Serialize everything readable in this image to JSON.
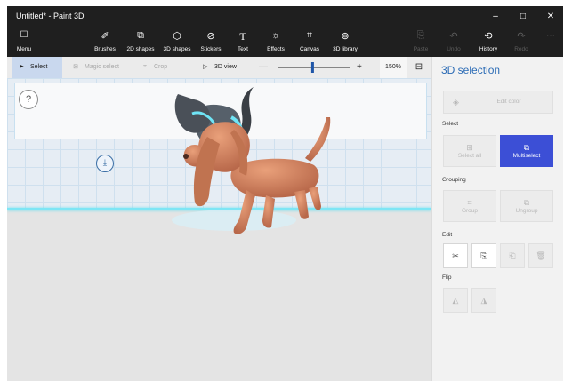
{
  "window": {
    "title": "Untitled* - Paint 3D",
    "controls": [
      {
        "name": "minimize-button",
        "glyph": "–"
      },
      {
        "name": "maximize-button",
        "glyph": "□"
      },
      {
        "name": "close-button",
        "glyph": "✕"
      }
    ]
  },
  "ribbon": {
    "menu": {
      "label": "Menu",
      "icon": "menu-icon",
      "glyph": "☐"
    },
    "tools": [
      {
        "label": "Brushes",
        "icon": "brush-icon",
        "glyph": "✐"
      },
      {
        "label": "2D shapes",
        "icon": "2d-shapes-icon",
        "glyph": "⧉"
      },
      {
        "label": "3D shapes",
        "icon": "3d-shapes-icon",
        "glyph": "⬡"
      },
      {
        "label": "Stickers",
        "icon": "stickers-icon",
        "glyph": "⊘"
      },
      {
        "label": "Text",
        "icon": "text-icon",
        "glyph": "T"
      },
      {
        "label": "Effects",
        "icon": "effects-icon",
        "glyph": "☼"
      },
      {
        "label": "Canvas",
        "icon": "canvas-icon",
        "glyph": "⌗"
      },
      {
        "label": "3D library",
        "icon": "3d-library-icon",
        "glyph": "⊛"
      }
    ],
    "right": [
      {
        "label": "Paste",
        "icon": "paste-icon",
        "glyph": "⎘",
        "enabled": false
      },
      {
        "label": "Undo",
        "icon": "undo-icon",
        "glyph": "↶",
        "enabled": false
      },
      {
        "label": "History",
        "icon": "history-icon",
        "glyph": "⟲",
        "enabled": true
      },
      {
        "label": "Redo",
        "icon": "redo-icon",
        "glyph": "↷",
        "enabled": false
      }
    ],
    "more": "···"
  },
  "toolbar": {
    "select": "Select",
    "magic_select": "Magic select",
    "crop": "Crop",
    "view_3d": "3D view",
    "zoom_minus": "—",
    "zoom_plus": "+",
    "zoom": "150%",
    "zoom_fraction": 0.48
  },
  "canvas": {
    "help": "?"
  },
  "panel": {
    "title": "3D selection",
    "edit_color": "Edit color",
    "select_label": "Select",
    "select_all": "Select all",
    "multiselect": "Multiselect",
    "grouping_label": "Grouping",
    "group": "Group",
    "ungroup": "Ungroup",
    "edit_label": "Edit",
    "flip_label": "Flip"
  }
}
